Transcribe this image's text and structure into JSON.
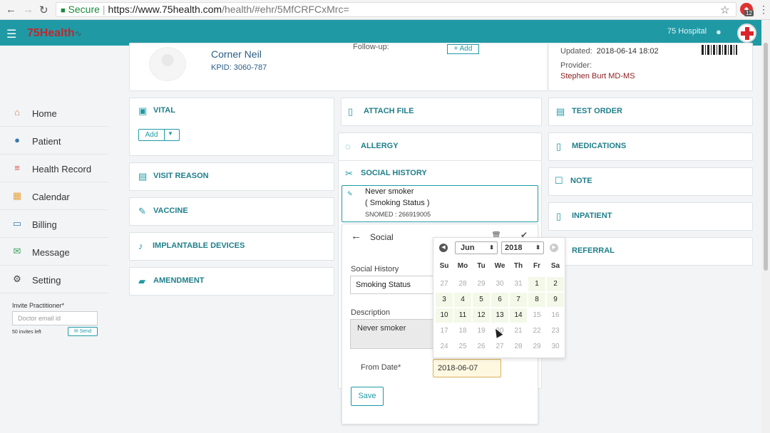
{
  "browser": {
    "secure_label": "Secure",
    "url_host": "https://www.75health.com",
    "url_path": "/health/#ehr/5MfCRFCxMrc=",
    "extension_badge": "12"
  },
  "app": {
    "logo_text": "75Health",
    "hospital": "75 Hospital"
  },
  "sidebar": {
    "items": [
      {
        "label": "Home",
        "icon": "home-icon",
        "color": "#e07b5a"
      },
      {
        "label": "Patient",
        "icon": "user-icon",
        "color": "#3b78b0"
      },
      {
        "label": "Health Record",
        "icon": "list-icon",
        "color": "#d9534f"
      },
      {
        "label": "Calendar",
        "icon": "calendar-icon",
        "color": "#e8a33b"
      },
      {
        "label": "Billing",
        "icon": "card-icon",
        "color": "#3b78b0"
      },
      {
        "label": "Message",
        "icon": "envelope-icon",
        "color": "#3aa05a"
      },
      {
        "label": "Setting",
        "icon": "gear-icon",
        "color": "#444444"
      }
    ],
    "invite_label": "Invite Practitioner*",
    "invite_placeholder": "Doctor email id",
    "invites_left": "50 invites left",
    "send_label": "Send"
  },
  "patient": {
    "name": "Corner Neil",
    "kpid": "KPID: 3060-787",
    "followup_label": "Follow-up:",
    "followup_add": "+ Add",
    "updated_label": "Updated:",
    "updated_value": "2018-06-14 18:02",
    "provider_label": "Provider:",
    "provider_name": "Stephen Burt MD-MS"
  },
  "sections_left": [
    {
      "title": "VITAL",
      "icon": "vital-icon"
    },
    {
      "title": "VISIT REASON",
      "icon": "visit-reason-icon"
    },
    {
      "title": "VACCINE",
      "icon": "vaccine-icon"
    },
    {
      "title": "IMPLANTABLE DEVICES",
      "icon": "implant-icon"
    },
    {
      "title": "AMENDMENT",
      "icon": "amendment-icon"
    }
  ],
  "vital_add_label": "Add",
  "sections_mid": [
    {
      "title": "ATTACH FILE",
      "icon": "attach-file-icon"
    },
    {
      "title": "ALLERGY",
      "icon": "allergy-icon"
    },
    {
      "title": "SOCIAL HISTORY",
      "icon": "social-history-icon"
    }
  ],
  "sections_right": [
    {
      "title": "TEST ORDER",
      "icon": "test-order-icon"
    },
    {
      "title": "MEDICATIONS",
      "icon": "medications-icon"
    },
    {
      "title": "NOTE",
      "icon": "note-icon"
    },
    {
      "title": "INPATIENT",
      "icon": "inpatient-icon"
    },
    {
      "title": "REFERRAL",
      "icon": "referral-icon"
    }
  ],
  "social_entry": {
    "line1": "Never smoker",
    "line2": "( Smoking Status )",
    "line3": "SNOMED : 266919005"
  },
  "social_form": {
    "title": "Social",
    "social_history_label": "Social History",
    "social_history_value": "Smoking Status",
    "description_label": "Description",
    "description_value": "Never smoker",
    "from_date_label": "From Date*",
    "from_date_value": "2018-06-07",
    "save_label": "Save"
  },
  "datepicker": {
    "month": "Jun",
    "year": "2018",
    "dow": [
      "Su",
      "Mo",
      "Tu",
      "We",
      "Th",
      "Fr",
      "Sa"
    ],
    "weeks": [
      [
        [
          "27",
          0
        ],
        [
          "28",
          0
        ],
        [
          "29",
          0
        ],
        [
          "30",
          0
        ],
        [
          "31",
          0
        ],
        [
          "1",
          1
        ],
        [
          "2",
          1
        ]
      ],
      [
        [
          "3",
          1
        ],
        [
          "4",
          1
        ],
        [
          "5",
          1
        ],
        [
          "6",
          1
        ],
        [
          "7",
          1
        ],
        [
          "8",
          1
        ],
        [
          "9",
          1
        ]
      ],
      [
        [
          "10",
          1
        ],
        [
          "11",
          1
        ],
        [
          "12",
          1
        ],
        [
          "13",
          1
        ],
        [
          "14",
          1
        ],
        [
          "15",
          0
        ],
        [
          "16",
          0
        ]
      ],
      [
        [
          "17",
          0
        ],
        [
          "18",
          0
        ],
        [
          "19",
          0
        ],
        [
          "20",
          0
        ],
        [
          "21",
          0
        ],
        [
          "22",
          0
        ],
        [
          "23",
          0
        ]
      ],
      [
        [
          "24",
          0
        ],
        [
          "25",
          0
        ],
        [
          "26",
          0
        ],
        [
          "27",
          0
        ],
        [
          "28",
          0
        ],
        [
          "29",
          0
        ],
        [
          "30",
          0
        ]
      ]
    ]
  },
  "colors": {
    "brand": "#1f9aa5",
    "logo_red": "#c0272d"
  }
}
